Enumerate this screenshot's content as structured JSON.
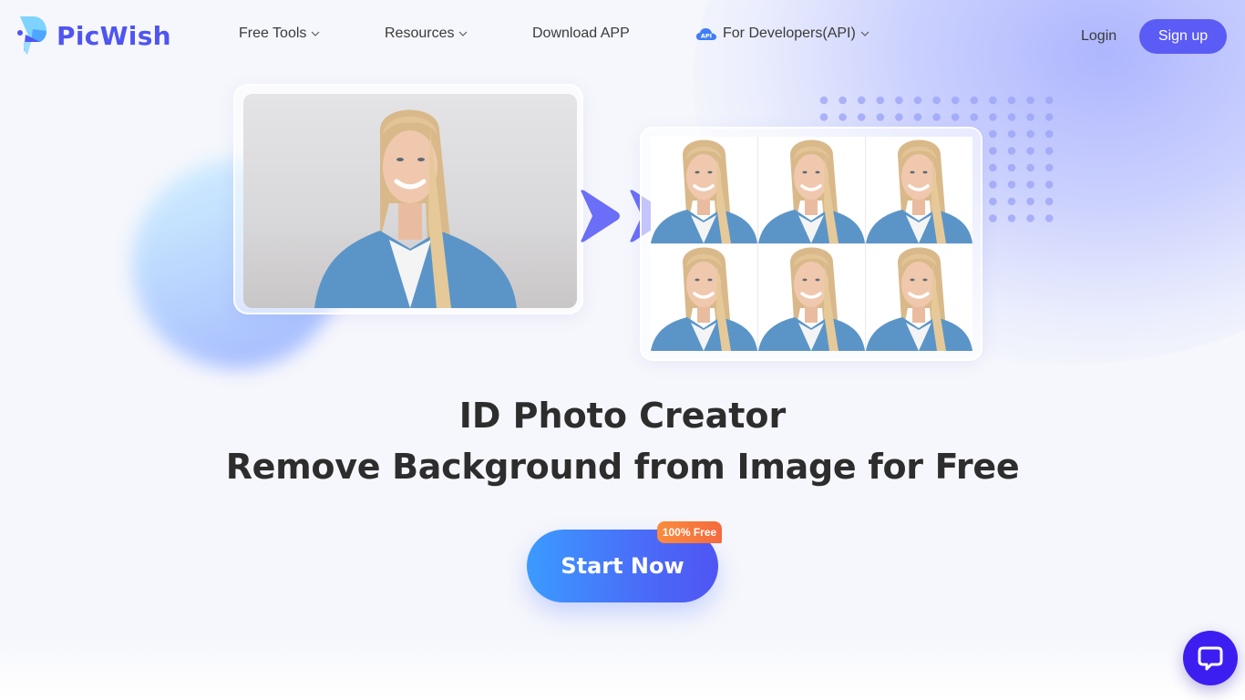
{
  "brand": {
    "name": "PicWish",
    "color": "#4f55f0"
  },
  "nav": {
    "items": [
      {
        "label": "Free Tools",
        "has_dropdown": true
      },
      {
        "label": "Resources",
        "has_dropdown": true
      },
      {
        "label": "Download APP",
        "has_dropdown": false
      },
      {
        "label": "For Developers(API)",
        "has_dropdown": true,
        "badge": "API"
      }
    ],
    "login_label": "Login",
    "signup_label": "Sign up"
  },
  "hero": {
    "title": "ID Photo Creator",
    "subtitle": "Remove Background from Image for Free",
    "cta_label": "Start Now",
    "cta_badge": "100% Free",
    "before_image": "portrait-gray-background",
    "after_image": "id-photo-grid-6"
  },
  "chat": {
    "icon": "chat-bubble-icon",
    "color": "#3d1ef0"
  },
  "colors": {
    "accent": "#5b5cf5",
    "cta_start": "#3b9bff",
    "cta_end": "#4f55f3",
    "badge": "#f46a3f",
    "arrow": "#6b6ef7"
  }
}
